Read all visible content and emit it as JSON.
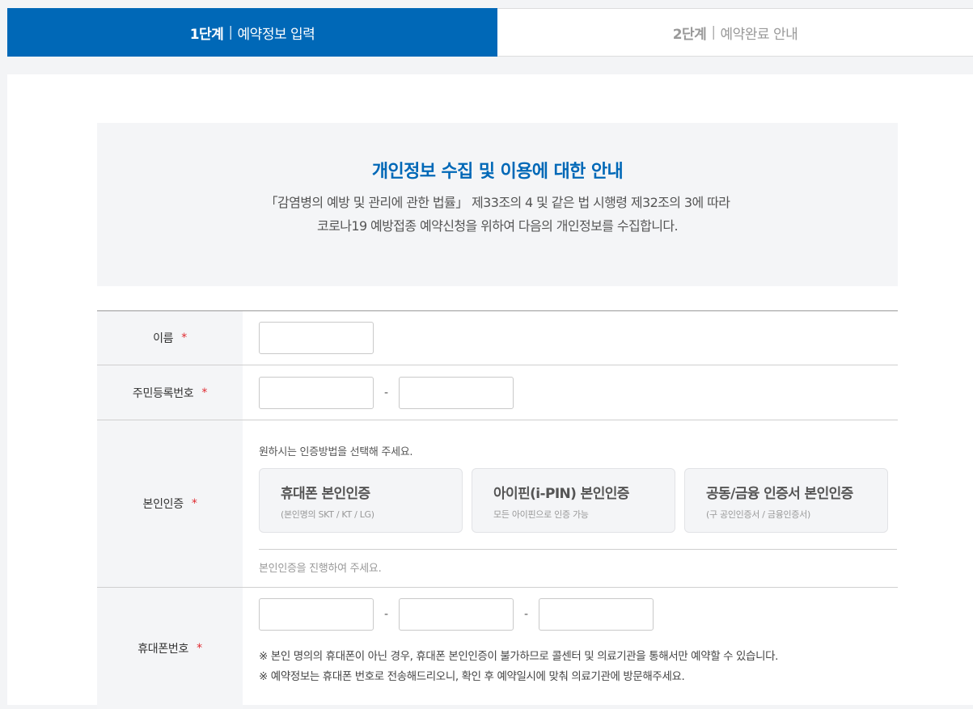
{
  "steps": [
    {
      "num": "1단계",
      "sep": "|",
      "label": "예약정보 입력"
    },
    {
      "num": "2단계",
      "sep": "|",
      "label": "예약완료 안내"
    }
  ],
  "notice": {
    "title": "개인정보 수집 및 이용에 대한 안내",
    "line1": "「감염병의 예방 및 관리에 관한 법률」 제33조의 4 및 같은 법 시행령 제32조의 3에 따라",
    "line2": "코로나19 예방접종 예약신청을 위하여 다음의 개인정보를 수집합니다."
  },
  "form": {
    "required_mark": "*",
    "dash": "-",
    "name": {
      "label": "이름",
      "value": ""
    },
    "rrn": {
      "label": "주민등록번호",
      "front": "",
      "back": ""
    },
    "auth": {
      "label": "본인인증",
      "guide": "원하시는 인증방법을 선택해 주세요.",
      "methods": [
        {
          "title": "휴대폰 본인인증",
          "sub": "(본인명의 SKT / KT / LG)"
        },
        {
          "title": "아이핀(i-PIN) 본인인증",
          "sub": "모든 아이핀으로 인증 가능"
        },
        {
          "title": "공동/금융 인증서 본인인증",
          "sub": "(구 공인인증서 / 금융인증서)"
        }
      ],
      "status": "본인인증을 진행하여 주세요."
    },
    "phone": {
      "label": "휴대폰번호",
      "part1": "",
      "part2": "",
      "part3": "",
      "note1": "※ 본인 명의의 휴대폰이 아닌 경우, 휴대폰 본인인증이 불가하므로 콜센터 및 의료기관을 통해서만 예약할 수 있습니다.",
      "note2": "※ 예약정보는 휴대폰 번호로 전송해드리오니, 확인 후 예약일시에 맞춰 의료기관에 방문해주세요."
    }
  },
  "colors": {
    "primary": "#0068b7",
    "required": "#e0292f"
  }
}
